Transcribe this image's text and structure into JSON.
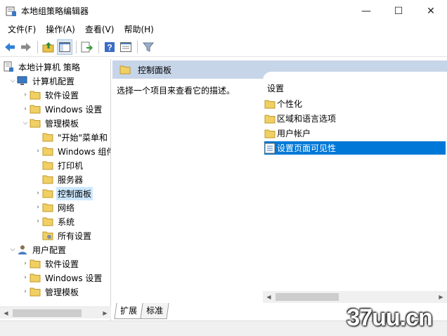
{
  "window": {
    "title": "本地组策略编辑器",
    "minimize": "—",
    "maximize": "☐",
    "close": "✕"
  },
  "menu": [
    "文件(F)",
    "操作(A)",
    "查看(V)",
    "帮助(H)"
  ],
  "toolbar_icons": [
    "back-icon",
    "forward-icon",
    "up-folder-icon",
    "show-hide-tree-icon",
    "export-list-icon",
    "help-icon",
    "properties-icon",
    "filter-icon"
  ],
  "tree": [
    {
      "label": "本地计算机 策略",
      "icon": "computer-policy-icon",
      "level": 0,
      "arrow": ""
    },
    {
      "label": "计算机配置",
      "icon": "computer-icon",
      "level": 1,
      "arrow": "expanded"
    },
    {
      "label": "软件设置",
      "icon": "folder-icon",
      "level": 2,
      "arrow": "collapsed"
    },
    {
      "label": "Windows 设置",
      "icon": "folder-icon",
      "level": 2,
      "arrow": "collapsed"
    },
    {
      "label": "管理模板",
      "icon": "folder-icon",
      "level": 2,
      "arrow": "expanded"
    },
    {
      "label": "\"开始\"菜单和",
      "icon": "folder-icon",
      "level": 3,
      "arrow": ""
    },
    {
      "label": "Windows 组件",
      "icon": "folder-icon",
      "level": 3,
      "arrow": "collapsed"
    },
    {
      "label": "打印机",
      "icon": "folder-icon",
      "level": 3,
      "arrow": ""
    },
    {
      "label": "服务器",
      "icon": "folder-icon",
      "level": 3,
      "arrow": ""
    },
    {
      "label": "控制面板",
      "icon": "folder-icon",
      "level": 3,
      "arrow": "collapsed",
      "selected": true
    },
    {
      "label": "网络",
      "icon": "folder-icon",
      "level": 3,
      "arrow": "collapsed"
    },
    {
      "label": "系统",
      "icon": "folder-icon",
      "level": 3,
      "arrow": "collapsed"
    },
    {
      "label": "所有设置",
      "icon": "settings-folder-icon",
      "level": 3,
      "arrow": ""
    },
    {
      "label": "用户配置",
      "icon": "user-icon",
      "level": 1,
      "arrow": "expanded"
    },
    {
      "label": "软件设置",
      "icon": "folder-icon",
      "level": 2,
      "arrow": "collapsed"
    },
    {
      "label": "Windows 设置",
      "icon": "folder-icon",
      "level": 2,
      "arrow": "collapsed"
    },
    {
      "label": "管理模板",
      "icon": "folder-icon",
      "level": 2,
      "arrow": "collapsed"
    }
  ],
  "right": {
    "header": "控制面板",
    "description": "选择一个项目来查看它的描述。",
    "list_header": "设置",
    "items": [
      {
        "label": "个性化",
        "icon": "folder-icon"
      },
      {
        "label": "区域和语言选项",
        "icon": "folder-icon"
      },
      {
        "label": "用户帐户",
        "icon": "folder-icon"
      },
      {
        "label": "设置页面可见性",
        "icon": "setting-icon",
        "selected": true
      }
    ]
  },
  "tabs": [
    "扩展",
    "标准"
  ],
  "watermark": "37uu.cn"
}
